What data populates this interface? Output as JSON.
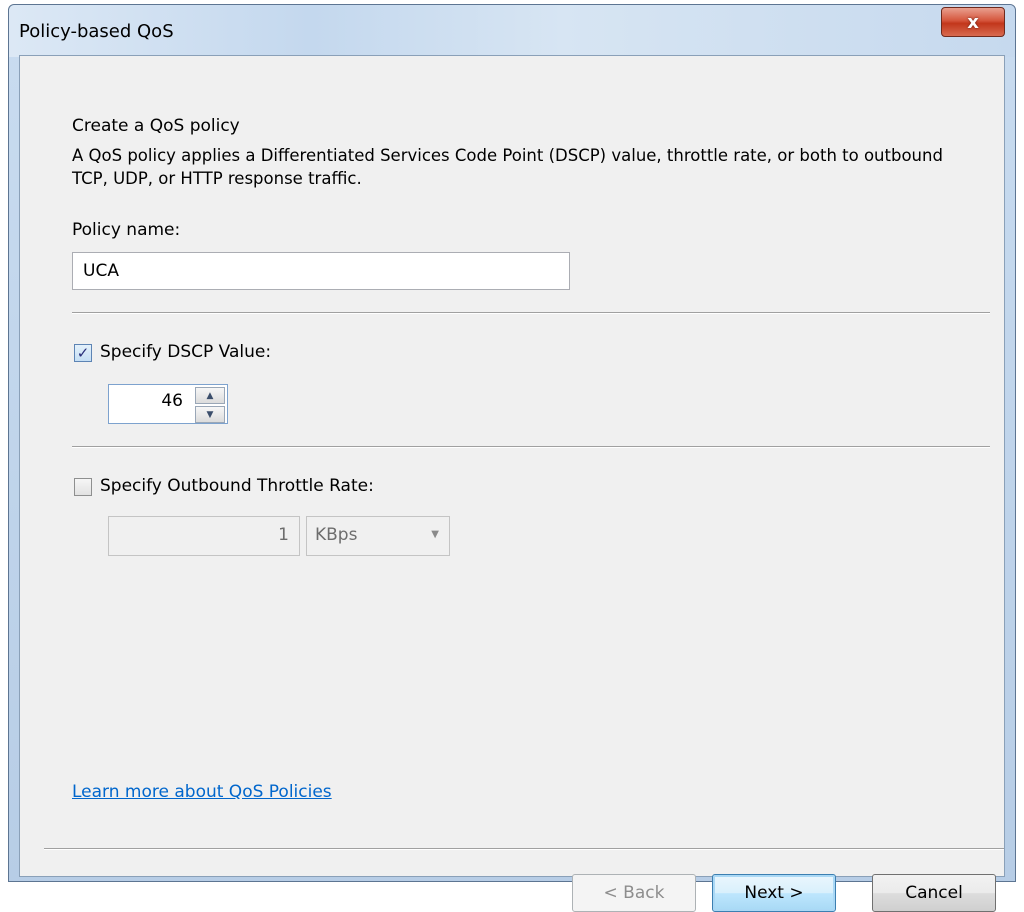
{
  "window": {
    "title": "Policy-based QoS",
    "close_label": "x"
  },
  "header": {
    "title": "Create a QoS policy",
    "description": "A QoS policy applies a Differentiated Services Code Point (DSCP) value, throttle rate, or both to outbound TCP, UDP, or HTTP response traffic."
  },
  "policy_name": {
    "label": "Policy name:",
    "value": "UCA"
  },
  "dscp": {
    "label": "Specify DSCP Value:",
    "checked": true,
    "value": "46"
  },
  "throttle": {
    "label": "Specify Outbound Throttle Rate:",
    "checked": false,
    "value": "1",
    "unit": "KBps"
  },
  "link": {
    "text": "Learn more about QoS Policies"
  },
  "buttons": {
    "back": "< Back",
    "next": "Next >",
    "cancel": "Cancel"
  },
  "icons": {
    "check": "✓",
    "up": "▲",
    "down": "▼",
    "dropdown": "▼"
  }
}
